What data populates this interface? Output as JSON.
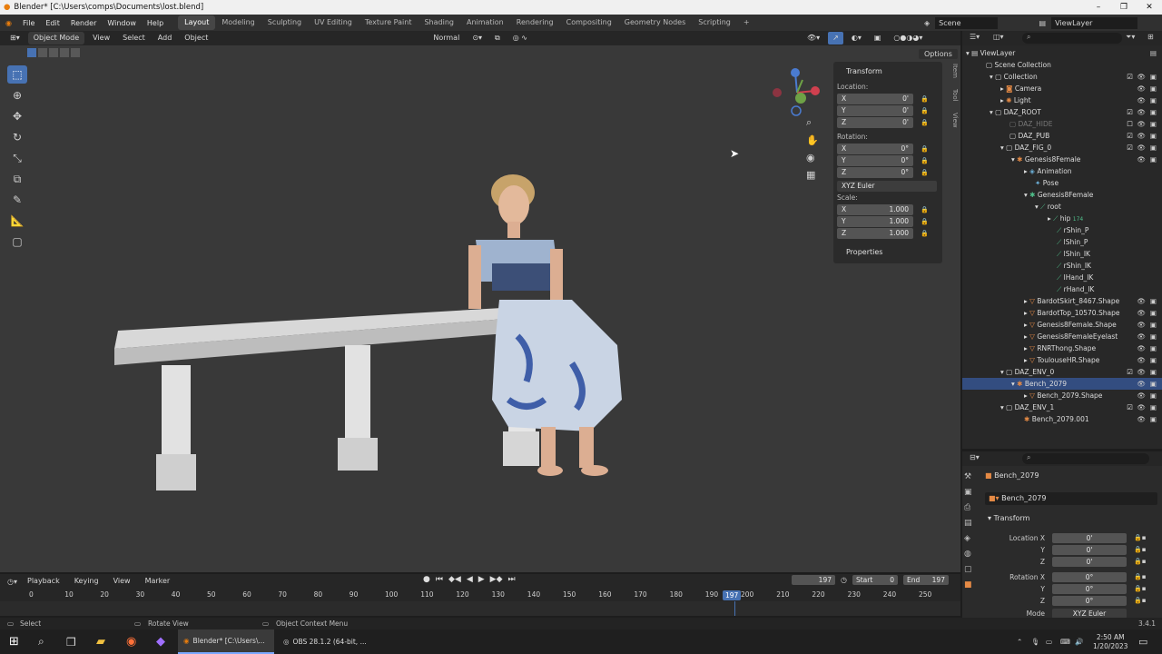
{
  "window": {
    "title": "Blender* [C:\\Users\\comps\\Documents\\lost.blend]",
    "min": "–",
    "max": "❐",
    "close": "✕"
  },
  "menu": {
    "items": [
      "File",
      "Edit",
      "Render",
      "Window",
      "Help"
    ]
  },
  "workspaces": {
    "tabs": [
      "Layout",
      "Modeling",
      "Sculpting",
      "UV Editing",
      "Texture Paint",
      "Shading",
      "Animation",
      "Rendering",
      "Compositing",
      "Geometry Nodes",
      "Scripting"
    ],
    "add": "+",
    "active": "Layout"
  },
  "scene": {
    "label": "Scene",
    "view_layer": "ViewLayer"
  },
  "viewport_header": {
    "mode": "Object Mode",
    "menus": [
      "View",
      "Select",
      "Add",
      "Object"
    ],
    "transform_orientation": "Normal",
    "options": "Options"
  },
  "npanel": {
    "title": "Transform",
    "location_label": "Location:",
    "rotation_label": "Rotation:",
    "scale_label": "Scale:",
    "location": [
      {
        "axis": "X",
        "value": "0'"
      },
      {
        "axis": "Y",
        "value": "0'"
      },
      {
        "axis": "Z",
        "value": "0'"
      }
    ],
    "rotation": [
      {
        "axis": "X",
        "value": "0°"
      },
      {
        "axis": "Y",
        "value": "0°"
      },
      {
        "axis": "Z",
        "value": "0°"
      }
    ],
    "rotation_mode": "XYZ Euler",
    "scale": [
      {
        "axis": "X",
        "value": "1.000"
      },
      {
        "axis": "Y",
        "value": "1.000"
      },
      {
        "axis": "Z",
        "value": "1.000"
      }
    ],
    "properties": "Properties",
    "tabs": [
      "Item",
      "Tool",
      "View"
    ]
  },
  "outliner": {
    "rows": [
      {
        "name": "ViewLayer"
      },
      {
        "name": "Scene Collection"
      },
      {
        "name": "Collection"
      },
      {
        "name": "Camera"
      },
      {
        "name": "Light"
      },
      {
        "name": "DAZ_ROOT"
      },
      {
        "name": "DAZ_HIDE"
      },
      {
        "name": "DAZ_PUB"
      },
      {
        "name": "DAZ_FIG_0"
      },
      {
        "name": "Genesis8Female"
      },
      {
        "name": "Animation"
      },
      {
        "name": "Pose"
      },
      {
        "name": "Genesis8Female"
      },
      {
        "name": "root"
      },
      {
        "name": "hip",
        "badge": "174"
      },
      {
        "name": "rShin_P"
      },
      {
        "name": "lShin_P"
      },
      {
        "name": "lShin_IK"
      },
      {
        "name": "rShin_IK"
      },
      {
        "name": "lHand_IK"
      },
      {
        "name": "rHand_IK"
      },
      {
        "name": "BardotSkirt_8467.Shape"
      },
      {
        "name": "BardotTop_10570.Shape"
      },
      {
        "name": "Genesis8Female.Shape"
      },
      {
        "name": "Genesis8FemaleEyelast"
      },
      {
        "name": "RNRThong.Shape"
      },
      {
        "name": "ToulouseHR.Shape"
      },
      {
        "name": "DAZ_ENV_0"
      },
      {
        "name": "Bench_2079"
      },
      {
        "name": "Bench_2079.Shape"
      },
      {
        "name": "DAZ_ENV_1"
      },
      {
        "name": "Bench_2079.001"
      }
    ]
  },
  "properties": {
    "object_name": "Bench_2079",
    "name_field": "Bench_2079",
    "section": "Transform",
    "location_labels": [
      "Location X",
      "Y",
      "Z"
    ],
    "location_values": [
      "0'",
      "0'",
      "0'"
    ],
    "rotation_labels": [
      "Rotation X",
      "Y",
      "Z"
    ],
    "rotation_values": [
      "0°",
      "0°",
      "0°"
    ],
    "mode_label": "Mode",
    "mode_value": "XYZ Euler"
  },
  "timeline": {
    "menus": [
      "Playback",
      "Keying",
      "View",
      "Marker"
    ],
    "current_frame": "197",
    "start_label": "Start",
    "start": "0",
    "end_label": "End",
    "end": "197",
    "ticks": [
      "0",
      "10",
      "20",
      "30",
      "40",
      "50",
      "60",
      "70",
      "80",
      "90",
      "100",
      "110",
      "120",
      "130",
      "140",
      "150",
      "160",
      "170",
      "180",
      "190",
      "200",
      "210",
      "220",
      "230",
      "240",
      "250"
    ],
    "playhead": "197"
  },
  "statusbar": {
    "select": "Select",
    "rotate": "Rotate View",
    "context": "Object Context Menu",
    "version": "3.4.1"
  },
  "taskbar": {
    "blender": "Blender* [C:\\Users\\...",
    "obs": "OBS 28.1.2 (64-bit, ...",
    "time": "2:50 AM",
    "date": "1/20/2023"
  },
  "colors": {
    "selected": "#334d80",
    "active_tool": "#4772b3",
    "viewport_bg": "#393939"
  }
}
